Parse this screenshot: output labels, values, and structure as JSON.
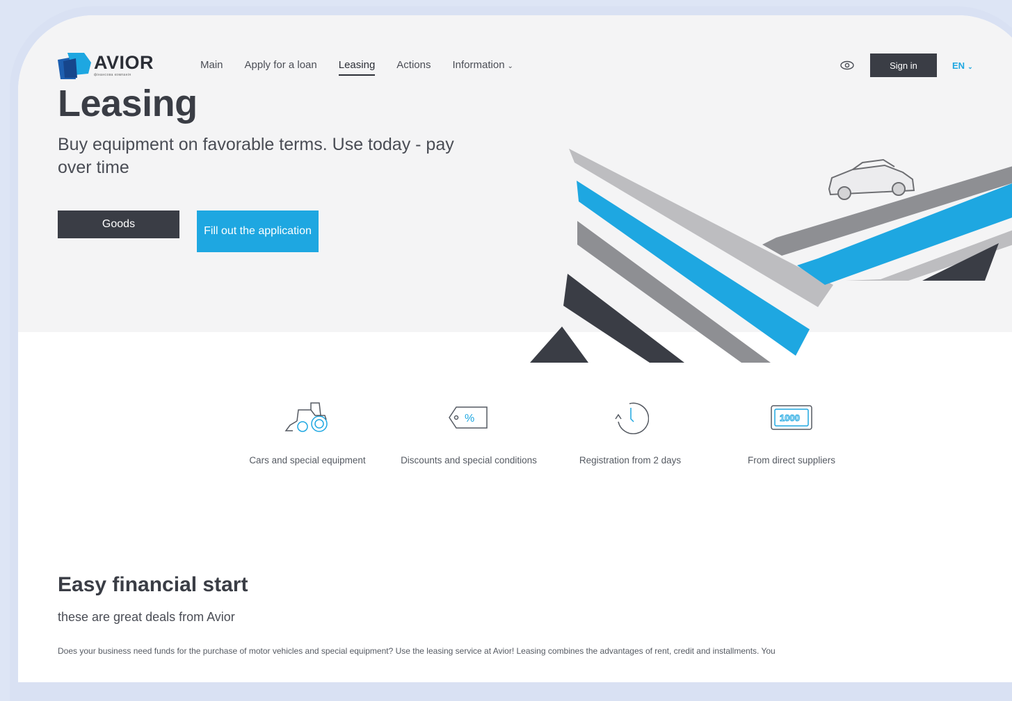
{
  "brand": {
    "name": "AVIOR",
    "tagline": "фінансова компанія"
  },
  "nav": {
    "items": [
      {
        "label": "Main"
      },
      {
        "label": "Apply for a loan"
      },
      {
        "label": "Leasing",
        "active": true
      },
      {
        "label": "Actions"
      },
      {
        "label": "Information",
        "dropdown": true
      }
    ]
  },
  "header": {
    "visibility_icon": "eye-icon",
    "signin_label": "Sign in",
    "lang_label": "EN"
  },
  "hero": {
    "title": "Leasing",
    "subtitle": "Buy equipment on favorable terms. Use today - pay over time",
    "goods_label": "Goods",
    "fill_label": "Fill out the application"
  },
  "features": [
    {
      "icon": "tractor-icon",
      "label": "Cars and special equipment"
    },
    {
      "icon": "discount-tag-icon",
      "label": "Discounts and special conditions"
    },
    {
      "icon": "clock-icon",
      "label": "Registration from 2 days"
    },
    {
      "icon": "banknote-icon",
      "label": "From direct suppliers"
    }
  ],
  "section": {
    "title": "Easy financial start",
    "subtitle": "these are great deals from Avior",
    "text": "Does your business need funds for the purchase of motor vehicles and special equipment? Use the leasing service at Avior! Leasing combines the advantages of rent, credit and installments. You"
  },
  "colors": {
    "accent": "#1ea7e1",
    "dark": "#3a3d45",
    "hero_bg": "#f4f4f5"
  }
}
